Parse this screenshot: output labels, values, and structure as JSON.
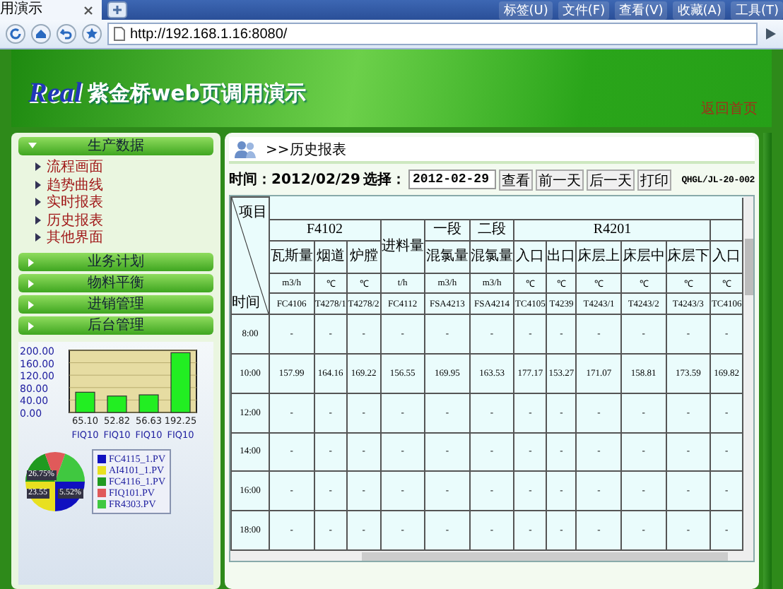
{
  "browser": {
    "tab_title": "用演示",
    "menu": [
      "标签(U)",
      "文件(F)",
      "查看(V)",
      "收藏(A)",
      "工具(T)"
    ],
    "address": "http://192.168.1.16:8080/"
  },
  "banner": {
    "logo": "Real",
    "title": "紫金桥web页调用演示",
    "home_link": "返回首页"
  },
  "sidebar": {
    "groups": [
      {
        "label": "生产数据",
        "expanded": true,
        "items": [
          "流程画面",
          "趋势曲线",
          "实时报表",
          "历史报表",
          "其他界面"
        ]
      },
      {
        "label": "业务计划",
        "expanded": false
      },
      {
        "label": "物料平衡",
        "expanded": false
      },
      {
        "label": "进销管理",
        "expanded": false
      },
      {
        "label": "后台管理",
        "expanded": false
      }
    ],
    "bar_chart": {
      "chart_data": {
        "type": "bar",
        "grid": true,
        "categories": [
          "FIQ10",
          "FIQ10",
          "FIQ10",
          "FIQ10"
        ],
        "values": [
          65.1,
          52.82,
          56.63,
          192.25
        ],
        "ylim": [
          0,
          200
        ],
        "yticks": [
          {
            "value": 0,
            "label": "0.00"
          },
          {
            "value": 40,
            "label": "40.00"
          },
          {
            "value": 80,
            "label": "80.00"
          },
          {
            "value": 120,
            "label": "120.00"
          },
          {
            "value": 160,
            "label": "160.00"
          },
          {
            "value": 200,
            "label": "200.00"
          }
        ],
        "value_labels": [
          "65.10",
          "52.82",
          "56.63",
          "192.25"
        ],
        "data_labels": true
      }
    },
    "pie": {
      "labels": [
        "26.75%",
        "23.55",
        "5.52%"
      ],
      "legend": [
        {
          "label": "FC4115_1.PV",
          "color": "#1010c0"
        },
        {
          "label": "AI4101_1.PV",
          "color": "#e8e020"
        },
        {
          "label": "FC4116_1.PV",
          "color": "#209a20"
        },
        {
          "label": "FIQ101.PV",
          "color": "#e05a5a"
        },
        {
          "label": "FR4303.PV",
          "color": "#40c840"
        }
      ]
    }
  },
  "panel": {
    "title": ">>历史报表",
    "toolbar": {
      "time": "时间：2012/02/29",
      "select_label": "选择：",
      "date": "2012-02-29",
      "buttons": [
        "查看",
        "前一天",
        "后一天",
        "打印"
      ],
      "code": "QHGL/JL-20-002"
    },
    "table": {
      "corner_top": "项目",
      "corner_bottom": "时间",
      "groups": [
        {
          "label": "F4102",
          "columns": [
            {
              "name": "瓦斯量",
              "unit": "m3/h",
              "tag": "FC4106"
            },
            {
              "name": "烟道",
              "unit": "℃",
              "tag": "T4278/1"
            },
            {
              "name": "炉膛",
              "unit": "℃",
              "tag": "T4278/2"
            }
          ]
        },
        {
          "label": "进料量",
          "columns": [
            {
              "unit": "t/h",
              "tag": "FC4112"
            }
          ]
        },
        {
          "label": "一段",
          "columns": [
            {
              "name": "混氯量",
              "unit": "m3/h",
              "tag": "FSA4213"
            }
          ]
        },
        {
          "label": "二段",
          "columns": [
            {
              "name": "混氯量",
              "unit": "m3/h",
              "tag": "FSA4214"
            }
          ]
        },
        {
          "label": "R4201",
          "columns": [
            {
              "name": "入口",
              "unit": "℃",
              "tag": "TC4105"
            },
            {
              "name": "出口",
              "unit": "℃",
              "tag": "T4239"
            },
            {
              "name": "床层上",
              "unit": "℃",
              "tag": "T4243/1"
            },
            {
              "name": "床层中",
              "unit": "℃",
              "tag": "T4243/2"
            },
            {
              "name": "床层下",
              "unit": "℃",
              "tag": "T4243/3"
            }
          ]
        },
        {
          "columns": [
            {
              "name": "入口",
              "unit": "℃",
              "tag": "TC4106"
            }
          ]
        }
      ],
      "rows": [
        {
          "time": "8:00",
          "values": [
            "-",
            "-",
            "-",
            "-",
            "-",
            "-",
            "-",
            "-",
            "-",
            "-",
            "-",
            "-"
          ]
        },
        {
          "time": "10:00",
          "values": [
            "157.99",
            "164.16",
            "169.22",
            "156.55",
            "169.95",
            "163.53",
            "177.17",
            "153.27",
            "171.07",
            "158.81",
            "173.59",
            "169.82"
          ]
        },
        {
          "time": "12:00",
          "values": [
            "-",
            "-",
            "-",
            "-",
            "-",
            "-",
            "-",
            "-",
            "-",
            "-",
            "-",
            "-"
          ]
        },
        {
          "time": "14:00",
          "values": [
            "-",
            "-",
            "-",
            "-",
            "-",
            "-",
            "-",
            "-",
            "-",
            "-",
            "-",
            "-"
          ]
        },
        {
          "time": "16:00",
          "values": [
            "-",
            "-",
            "-",
            "-",
            "-",
            "-",
            "-",
            "-",
            "-",
            "-",
            "-",
            "-"
          ]
        },
        {
          "time": "18:00",
          "values": [
            "-",
            "-",
            "-",
            "-",
            "-",
            "-",
            "-",
            "-",
            "-",
            "-",
            "-",
            "-"
          ]
        }
      ]
    }
  }
}
